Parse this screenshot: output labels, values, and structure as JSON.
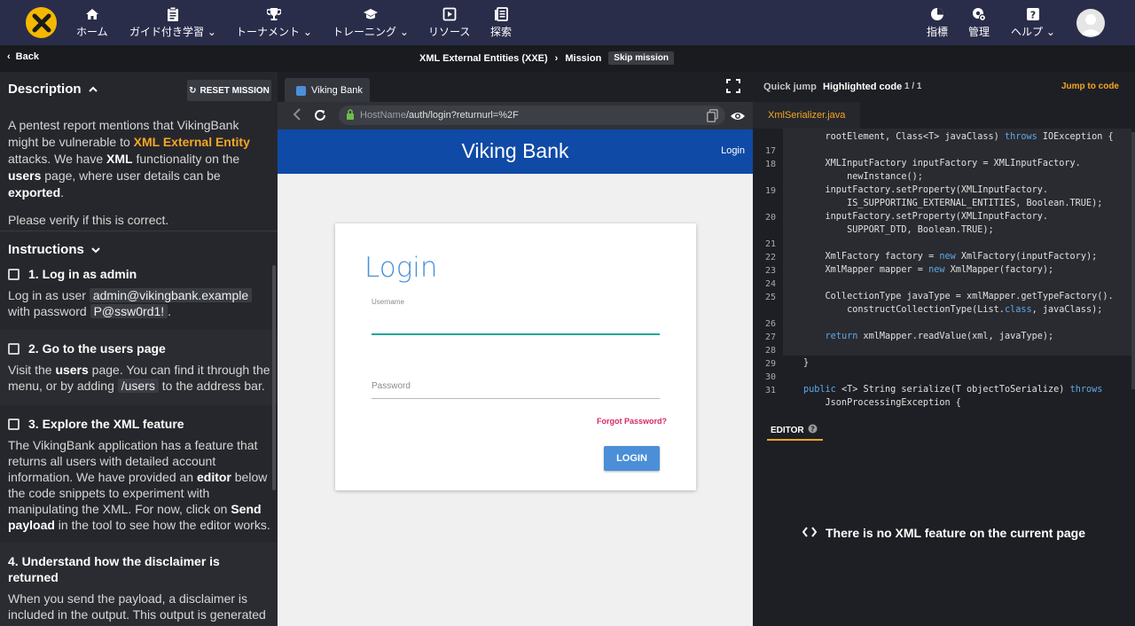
{
  "nav": {
    "items": [
      {
        "label": "ホーム",
        "icon": "home-icon"
      },
      {
        "label": "ガイド付き学習",
        "icon": "clipboard-icon"
      },
      {
        "label": "トーナメント",
        "icon": "trophy-icon"
      },
      {
        "label": "トレーニング",
        "icon": "graduation-cap-icon"
      },
      {
        "label": "リソース",
        "icon": "play-square-icon"
      },
      {
        "label": "探索",
        "icon": "library-icon"
      },
      {
        "label": "指標",
        "icon": "pie-chart-icon"
      },
      {
        "label": "管理",
        "icon": "admin-gear-icon"
      },
      {
        "label": "ヘルプ",
        "icon": "help-icon"
      }
    ]
  },
  "crumbbar": {
    "back": "Back",
    "crumb1": "XML External Entities (XXE)",
    "crumb2": "Mission",
    "skip": "Skip mission"
  },
  "left": {
    "desc_title": "Description",
    "reset": "RESET MISSION",
    "desc_p1_a": "A pentest report mentions that VikingBank might be vulnerable to ",
    "desc_p1_hl": "XML External Entity",
    "desc_p1_b": " attacks. We have ",
    "desc_p1_xml": "XML",
    "desc_p1_c": " functionality on the ",
    "desc_p1_users": "users",
    "desc_p1_d": " page, where user details can be ",
    "desc_p1_exported": "exported",
    "desc_p1_e": ".",
    "desc_p2": "Please verify if this is correct.",
    "instr_title": "Instructions",
    "step1_title": "1. Log in as admin",
    "step1_a": "Log in as user ",
    "step1_user": "admin@vikingbank.example",
    "step1_b": " with password ",
    "step1_pw": "P@ssw0rd1!",
    "step1_c": ".",
    "step2_title": "2. Go to the users page",
    "step2_a": "Visit the ",
    "step2_users": "users",
    "step2_b": " page. You can find it through the menu, or by adding ",
    "step2_code": "/users",
    "step2_c": " to the address bar.",
    "step3_title": "3. Explore the XML feature",
    "step3_a": "The VikingBank application has a feature that returns all users with detailed account information. We have provided an ",
    "step3_editor": "editor",
    "step3_b": " below the code snippets to experiment with manipulating the XML. For now, click on ",
    "step3_send": "Send payload",
    "step3_c": " in the tool to see how the editor works.",
    "step4_title": "4. Understand how the disclaimer is returned",
    "step4_text": "When you send the payload, a disclaimer is included in the output. This output is generated because the XML has an entity, called"
  },
  "browser": {
    "tab": "Viking Bank",
    "url_host": "HostName",
    "url_path": "/auth/login?returnurl=%2F",
    "bank_title": "Viking Bank",
    "bank_login": "Login",
    "login_title": "Login",
    "username_label": "Username",
    "password_label": "Password",
    "forgot": "Forgot Password?",
    "login_button": "LOGIN"
  },
  "right": {
    "quick_jump": "Quick jump",
    "highlighted": "Highlighted code",
    "count": "1 / 1",
    "jump": "Jump to code",
    "file": "XmlSerializer.java",
    "editor": "EDITOR",
    "no_xml": "There is no XML feature on the current page",
    "code_lines": [
      {
        "n": "",
        "t": "    rootElement, Class<T> javaClass) throws IOException {"
      },
      {
        "n": "17",
        "t": ""
      },
      {
        "n": "18",
        "t": "    XMLInputFactory inputFactory = XMLInputFactory."
      },
      {
        "n": "",
        "t": "        newInstance();"
      },
      {
        "n": "19",
        "t": "    inputFactory.setProperty(XMLInputFactory."
      },
      {
        "n": "",
        "t": "        IS_SUPPORTING_EXTERNAL_ENTITIES, Boolean.TRUE);"
      },
      {
        "n": "20",
        "t": "    inputFactory.setProperty(XMLInputFactory."
      },
      {
        "n": "",
        "t": "        SUPPORT_DTD, Boolean.TRUE);"
      },
      {
        "n": "21",
        "t": ""
      },
      {
        "n": "22",
        "t": "    XmlFactory factory = new XmlFactory(inputFactory);"
      },
      {
        "n": "23",
        "t": "    XmlMapper mapper = new XmlMapper(factory);"
      },
      {
        "n": "24",
        "t": ""
      },
      {
        "n": "25",
        "t": "    CollectionType javaType = xmlMapper.getTypeFactory()."
      },
      {
        "n": "",
        "t": "        constructCollectionType(List.class, javaClass);"
      },
      {
        "n": "26",
        "t": ""
      },
      {
        "n": "27",
        "t": "    return xmlMapper.readValue(xml, javaType);"
      },
      {
        "n": "28",
        "t": ""
      },
      {
        "n": "29",
        "t": "}"
      },
      {
        "n": "30",
        "t": ""
      },
      {
        "n": "31",
        "t": "public <T> String serialize(T objectToSerialize) throws"
      },
      {
        "n": "",
        "t": "    JsonProcessingException {"
      }
    ]
  }
}
